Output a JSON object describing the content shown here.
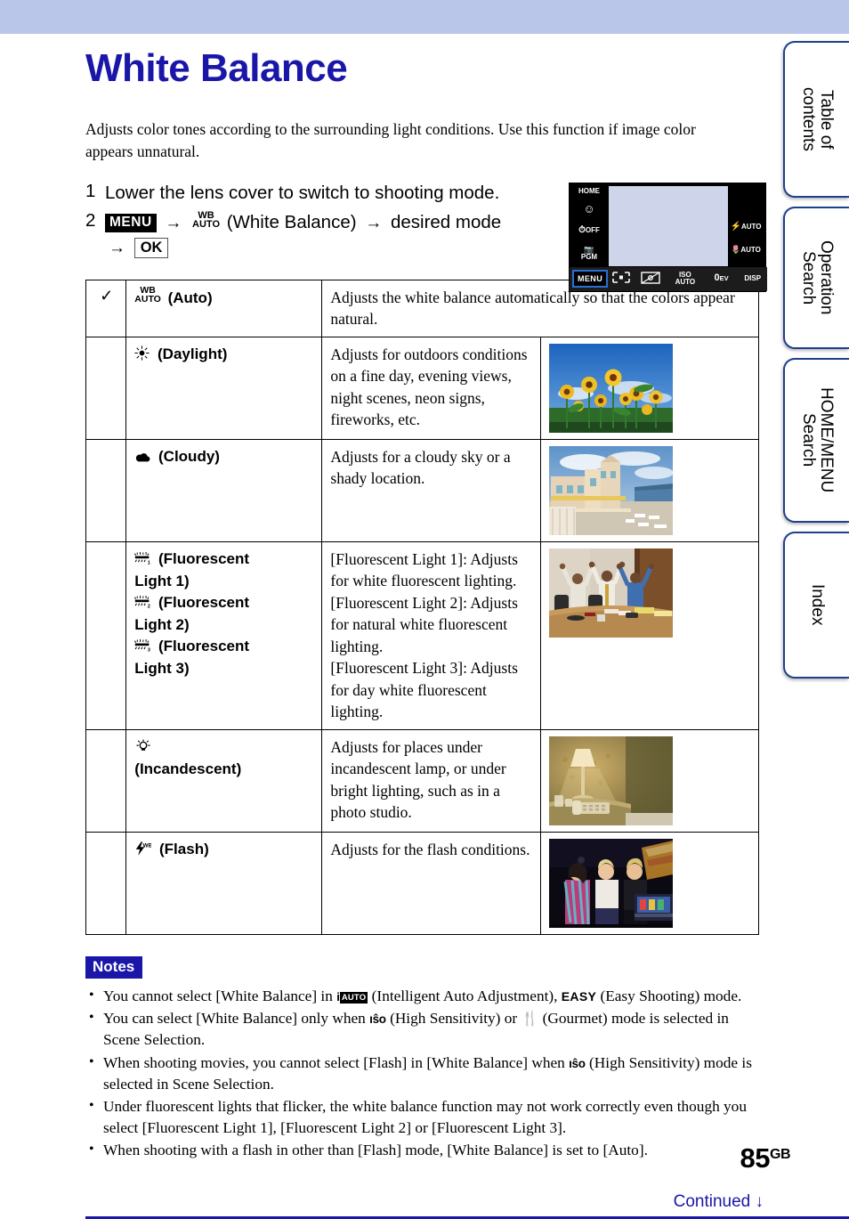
{
  "document": {
    "title": "White Balance",
    "intro": "Adjusts color tones according to the surrounding light conditions. Use this function if image color appears unnatural."
  },
  "side_tabs": [
    {
      "label": "Table of\ncontents",
      "name": "table-of-contents"
    },
    {
      "label": "Operation\nSearch",
      "name": "operation-search"
    },
    {
      "label": "HOME/MENU\nSearch",
      "name": "home-menu-search"
    },
    {
      "label": "Index",
      "name": "index"
    }
  ],
  "steps": [
    {
      "num": "1",
      "text": "Lower the lens cover to switch to shooting mode."
    },
    {
      "num": "2",
      "menu_chip": "MENU",
      "wb_top": "WB",
      "wb_bottom": "AUTO",
      "mid_text": "(White Balance)",
      "after_text": "desired mode",
      "ok_chip": "OK",
      "arrow": "→"
    }
  ],
  "camera_screen": {
    "left_icons": [
      {
        "name": "home-icon",
        "label": "HOME"
      },
      {
        "name": "smile-shutter-icon",
        "label": "☺"
      },
      {
        "name": "self-timer-off-icon",
        "label": "OFF"
      },
      {
        "name": "program-mode-icon",
        "label": "PGM"
      }
    ],
    "right_icons": [
      {
        "name": "flash-auto-icon",
        "label": "AUTO"
      },
      {
        "name": "macro-auto-icon",
        "label": "AUTO"
      }
    ],
    "bottom_items": [
      {
        "name": "menu-button",
        "label": "MENU"
      },
      {
        "name": "focus-icon",
        "label": ""
      },
      {
        "name": "metering-icon",
        "label": ""
      },
      {
        "name": "iso-setting",
        "label": "ISO\nAUTO"
      },
      {
        "name": "ev-setting",
        "label": "0EV"
      },
      {
        "name": "disp-button",
        "label": "DISP"
      }
    ]
  },
  "table": {
    "rows": [
      {
        "checked": true,
        "check_glyph": "✓",
        "icon": "wb-auto-icon",
        "icon_top": "WB",
        "icon_bottom": "AUTO",
        "mode": "(Auto)",
        "description": "Adjusts the white balance automatically so that the colors appear natural.",
        "photo": "none",
        "photo_caption": ""
      },
      {
        "checked": false,
        "icon": "daylight-sun-icon",
        "mode": "(Daylight)",
        "description": "Adjusts for outdoors conditions on a fine day, evening views, night scenes, neon signs, fireworks, etc.",
        "photo": "sunflowers-blue-sky",
        "photo_caption": "Sunflower field under a blue sky"
      },
      {
        "checked": false,
        "icon": "cloudy-cloud-icon",
        "mode": "(Cloudy)",
        "description": "Adjusts for a cloudy sky or a shady location.",
        "photo": "seaside-hotel-building",
        "photo_caption": "Seaside hotel building under cloudy sky"
      },
      {
        "checked": false,
        "icon": "fluorescent-light-icon",
        "mode": "(Fluorescent Light 1)\n(Fluorescent Light 2)\n(Fluorescent Light 3)",
        "mode_lines": [
          "(Fluorescent",
          "Light 1)",
          "(Fluorescent",
          "Light 2)",
          "(Fluorescent",
          "Light 3)"
        ],
        "description": "[Fluorescent Light 1]: Adjusts for white fluorescent lighting.\n[Fluorescent Light 2]: Adjusts for natural white fluorescent lighting.\n[Fluorescent Light 3]: Adjusts for day white fluorescent lighting.",
        "desc_lines": [
          "[Fluorescent Light 1]: Adjusts for white fluorescent lighting.",
          "[Fluorescent Light 2]: Adjusts for natural white fluorescent lighting.",
          "[Fluorescent Light 3]: Adjusts for day white fluorescent lighting."
        ],
        "photo": "office-people-celebrating",
        "photo_caption": "Office workers celebrating at a table"
      },
      {
        "checked": false,
        "icon": "incandescent-bulb-icon",
        "mode": "(Incandescent)",
        "description": "Adjusts for places under incandescent lamp, or under bright lighting, such as in a photo studio.",
        "photo": "lamp-and-telephone",
        "photo_caption": "Table lamp and telephone in a warm-lit room"
      },
      {
        "checked": false,
        "icon": "flash-wb-icon",
        "mode": "(Flash)",
        "description": "Adjusts for the flash conditions.",
        "photo": "three-women-night-flash",
        "photo_caption": "Three women photographed with flash at night"
      }
    ]
  },
  "notes": {
    "heading": "Notes",
    "items": [
      {
        "segments": [
          {
            "type": "text",
            "value": "You cannot select [White Balance] in "
          },
          {
            "type": "icon",
            "value": "intelligent-auto-icon"
          },
          {
            "type": "text",
            "value": " (Intelligent Auto Adjustment), "
          },
          {
            "type": "icon",
            "value": "easy-shooting-icon"
          },
          {
            "type": "text",
            "value": " (Easy Shooting) mode."
          }
        ],
        "plain": "You cannot select [White Balance] in (Intelligent Auto Adjustment), EASY (Easy Shooting) mode."
      },
      {
        "plain": "You can select [White Balance] only when (High Sensitivity) or (Gourmet) mode is selected in Scene Selection."
      },
      {
        "plain": "When shooting movies, you cannot select [Flash] in [White Balance] when (High Sensitivity) mode is selected in Scene Selection."
      },
      {
        "plain": "Under fluorescent lights that flicker, the white balance function may not work correctly even though you select [Fluorescent Light 1], [Fluorescent Light 2] or [Fluorescent Light 3]."
      },
      {
        "plain": "When shooting with a flash in other than [Flash] mode, [White Balance] is set to [Auto]."
      }
    ],
    "note1_a": "You cannot select [White Balance] in ",
    "note1_b": " (Intelligent Auto Adjustment), ",
    "note1_c": " (Easy Shooting) mode.",
    "note2_a": "You can select [White Balance] only when ",
    "note2_b": " (High Sensitivity) or ",
    "note2_c": " (Gourmet) mode is selected in Scene Selection.",
    "note3_a": "When shooting movies, you cannot select [Flash] in [White Balance] when ",
    "note3_b": " (High Sensitivity) mode is selected in Scene Selection.",
    "note4": "Under fluorescent lights that flicker, the white balance function may not work correctly even though you select [Fluorescent Light 1], [Fluorescent Light 2] or [Fluorescent Light 3].",
    "note5": "When shooting with a flash in other than [Flash] mode, [White Balance] is set to [Auto]."
  },
  "footer": {
    "page_number": "85",
    "page_suffix": "GB",
    "continued": "Continued",
    "continued_arrow": "↓"
  },
  "colors": {
    "title_blue": "#1a17a8",
    "band_blue": "#b9c5e9",
    "tab_border": "#1f3f8f",
    "menu_highlight": "#2a6fd4"
  }
}
